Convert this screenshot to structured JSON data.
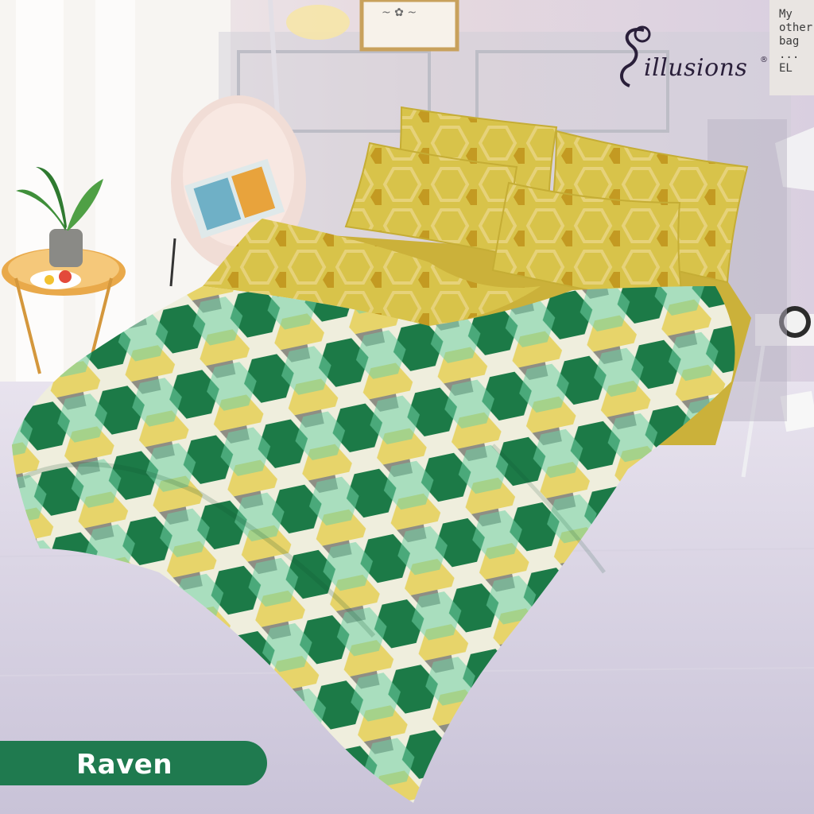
{
  "brand": {
    "name": "illusions",
    "registered": "®"
  },
  "product": {
    "label": "Raven"
  },
  "wall_note": {
    "text": "My other bag ... EL"
  },
  "colors": {
    "label_bg": "#1f7a4f",
    "pillow_yellow": "#d8c34a",
    "dark_green": "#1c7a47",
    "mint": "#6fd0a4",
    "gray": "#8e8e84",
    "mustard": "#c9a12a",
    "light_yellow": "#e7d46a"
  }
}
